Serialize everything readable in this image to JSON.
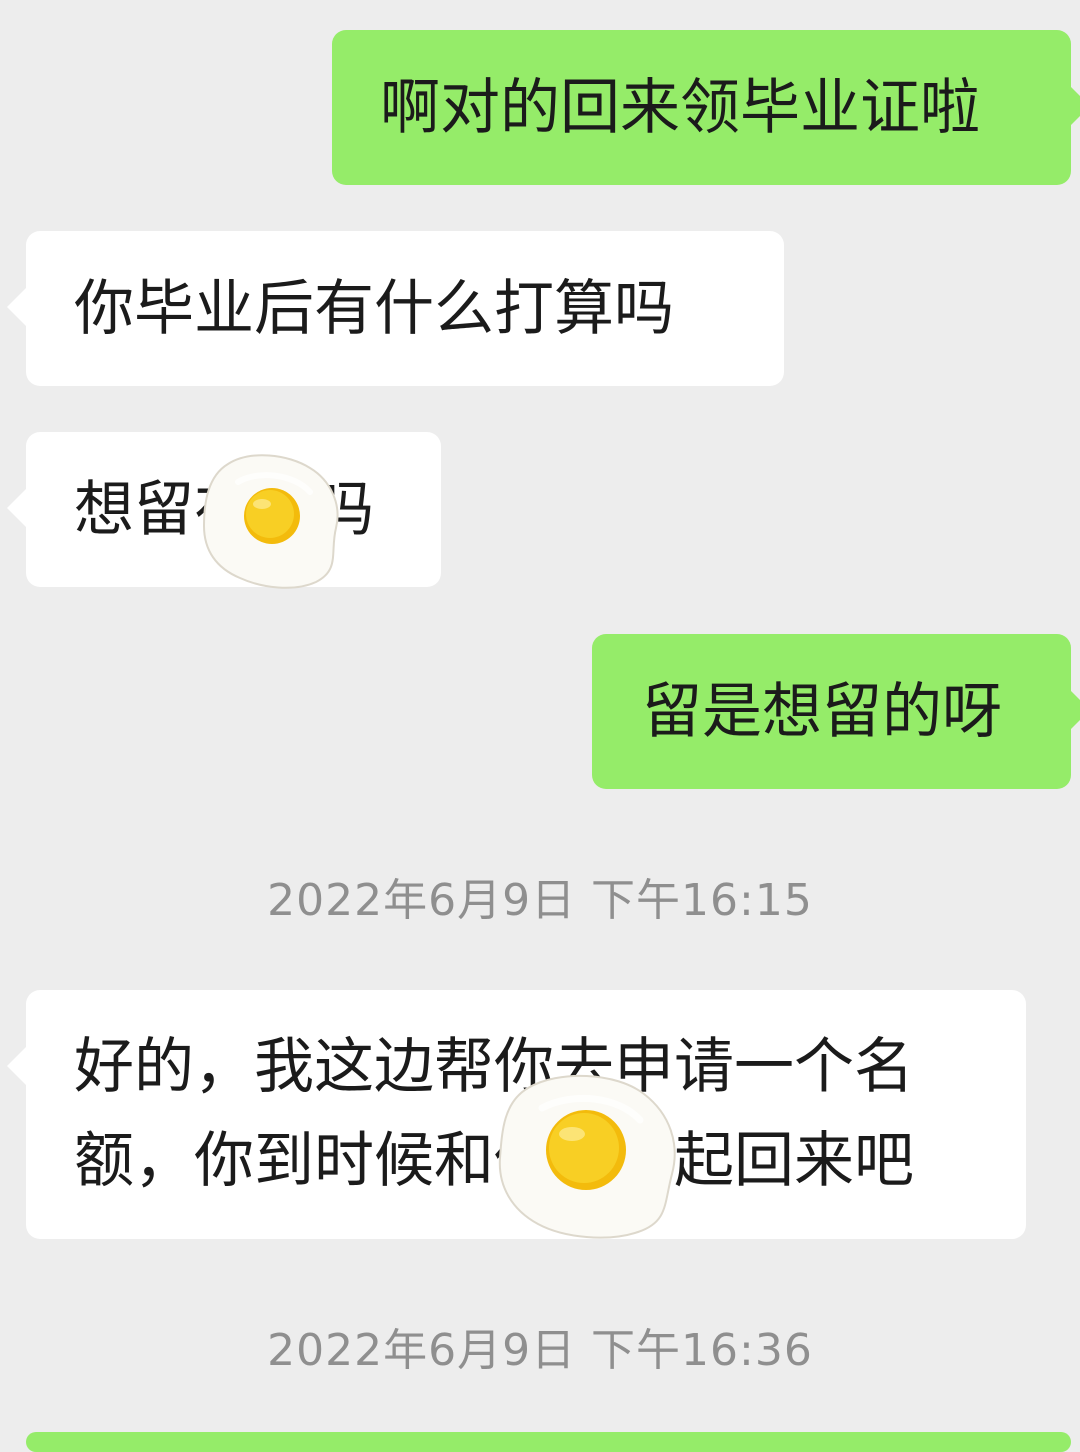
{
  "messages": [
    {
      "side": "out",
      "text": "啊对的回来领毕业证啦"
    },
    {
      "side": "in",
      "text": "你毕业后有什么打算吗"
    },
    {
      "side": "in",
      "text": "想留在这吗"
    },
    {
      "side": "out",
      "text": "留是想留的呀"
    },
    {
      "side": "in",
      "text": "好的，我这边帮你去申请一个名额，你到时候和他们一起回来吧"
    }
  ],
  "timestamps": [
    "2022年6月9日 下午16:15",
    "2022年6月9日 下午16:36"
  ],
  "stickers": [
    {
      "icon": "fried-egg-icon"
    },
    {
      "icon": "fried-egg-icon"
    }
  ],
  "colors": {
    "background": "#ededed",
    "outgoing_bubble": "#95ec69",
    "incoming_bubble": "#ffffff",
    "timestamp_text": "#8f8f8f",
    "egg_yolk": "#f6c20d"
  }
}
